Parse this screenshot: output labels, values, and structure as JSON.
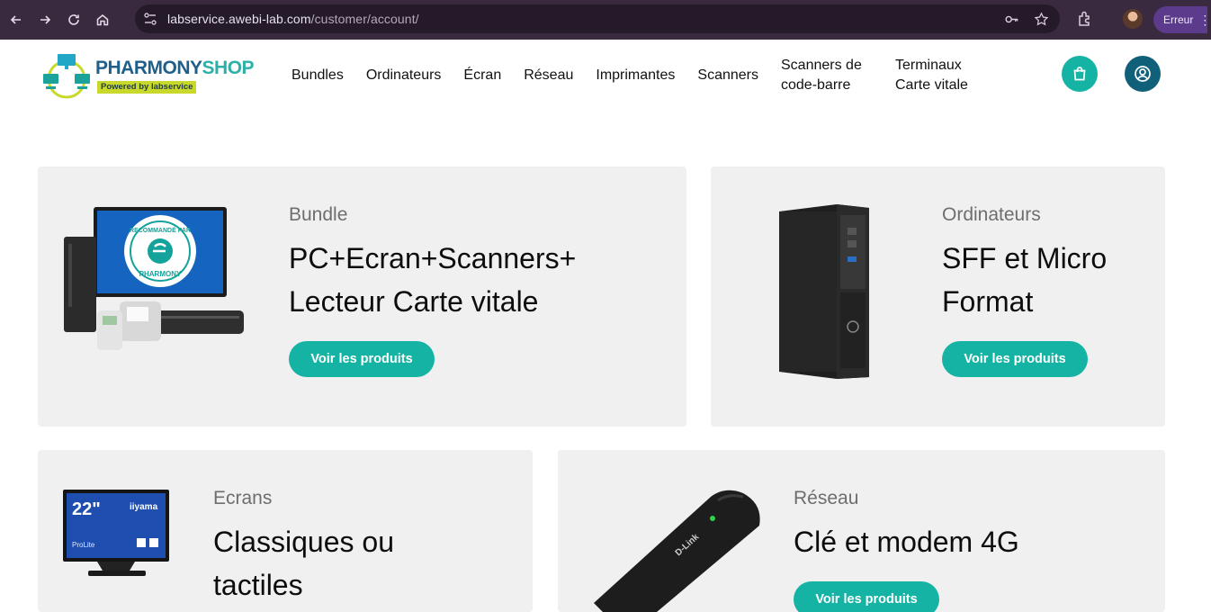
{
  "browser": {
    "url_host": "labservice.awebi-lab.com",
    "url_path": "/customer/account/",
    "error_label": "Erreur"
  },
  "site": {
    "logo": {
      "brand_part1": "PHARMONY",
      "brand_part2": "SHOP",
      "tagline": "Powered by labservice"
    },
    "nav": [
      {
        "line1": "Bundles"
      },
      {
        "line1": "Ordinateurs"
      },
      {
        "line1": "Écran"
      },
      {
        "line1": "Réseau"
      },
      {
        "line1": "Imprimantes"
      },
      {
        "line1": "Scanners"
      },
      {
        "line1": "Scanners de",
        "line2": "code-barre"
      },
      {
        "line1": "Terminaux",
        "line2": "Carte vitale"
      }
    ],
    "icons": {
      "cart": "shopping-bag-icon",
      "account": "user-circle-icon"
    },
    "colors": {
      "accent": "#14b3a4",
      "account": "#11607a",
      "card_bg": "#f0f0f0"
    }
  },
  "cards": [
    {
      "category": "Bundle",
      "title_line1": "PC+Ecran+Scanners+",
      "title_line2": "Lecteur Carte vitale",
      "button": "Voir les produits",
      "image_text": [
        "RECOMMANDÉ PAR",
        "PHARMONY"
      ]
    },
    {
      "category": "Ordinateurs",
      "title_line1": "SFF et Micro",
      "title_line2": "Format",
      "button": "Voir les produits"
    },
    {
      "category": "Ecrans",
      "title_line1": "Classiques ou",
      "title_line2": "tactiles",
      "image_text": [
        "22\"",
        "iiyama",
        "ProLite"
      ]
    },
    {
      "category": "Réseau",
      "title_line1": "Clé et modem 4G",
      "button": "Voir les produits",
      "image_text": [
        "D-Link"
      ]
    }
  ]
}
